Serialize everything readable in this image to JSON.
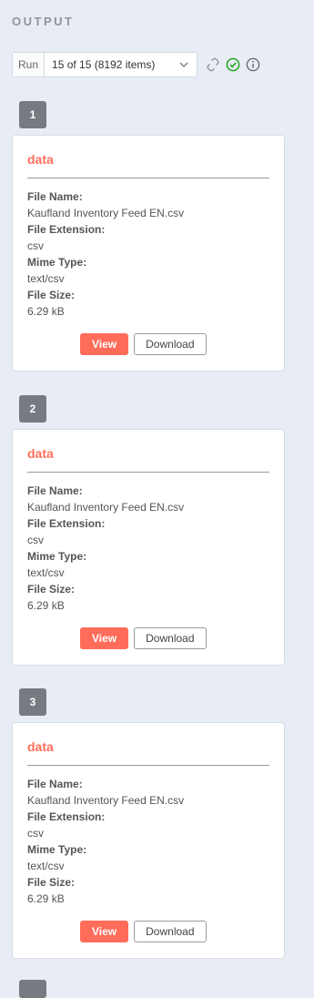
{
  "header": {
    "title": "OUTPUT"
  },
  "run_selector": {
    "label": "Run",
    "value": "15 of 15 (8192 items)"
  },
  "toolbar_icons": [
    "link-refresh-icon",
    "check-circle-icon",
    "info-icon"
  ],
  "colors": {
    "accent": "#ff6d5a",
    "success": "#13a10e",
    "badge": "#777a80"
  },
  "items": [
    {
      "index": "1",
      "title": "data",
      "fields": [
        {
          "key": "File Name:",
          "value": "Kaufland Inventory Feed EN.csv"
        },
        {
          "key": "File Extension:",
          "value": "csv"
        },
        {
          "key": "Mime Type:",
          "value": "text/csv"
        },
        {
          "key": "File Size:",
          "value": "6.29 kB"
        }
      ],
      "view_label": "View",
      "download_label": "Download"
    },
    {
      "index": "2",
      "title": "data",
      "fields": [
        {
          "key": "File Name:",
          "value": "Kaufland Inventory Feed EN.csv"
        },
        {
          "key": "File Extension:",
          "value": "csv"
        },
        {
          "key": "Mime Type:",
          "value": "text/csv"
        },
        {
          "key": "File Size:",
          "value": "6.29 kB"
        }
      ],
      "view_label": "View",
      "download_label": "Download"
    },
    {
      "index": "3",
      "title": "data",
      "fields": [
        {
          "key": "File Name:",
          "value": "Kaufland Inventory Feed EN.csv"
        },
        {
          "key": "File Extension:",
          "value": "csv"
        },
        {
          "key": "Mime Type:",
          "value": "text/csv"
        },
        {
          "key": "File Size:",
          "value": "6.29 kB"
        }
      ],
      "view_label": "View",
      "download_label": "Download"
    }
  ]
}
